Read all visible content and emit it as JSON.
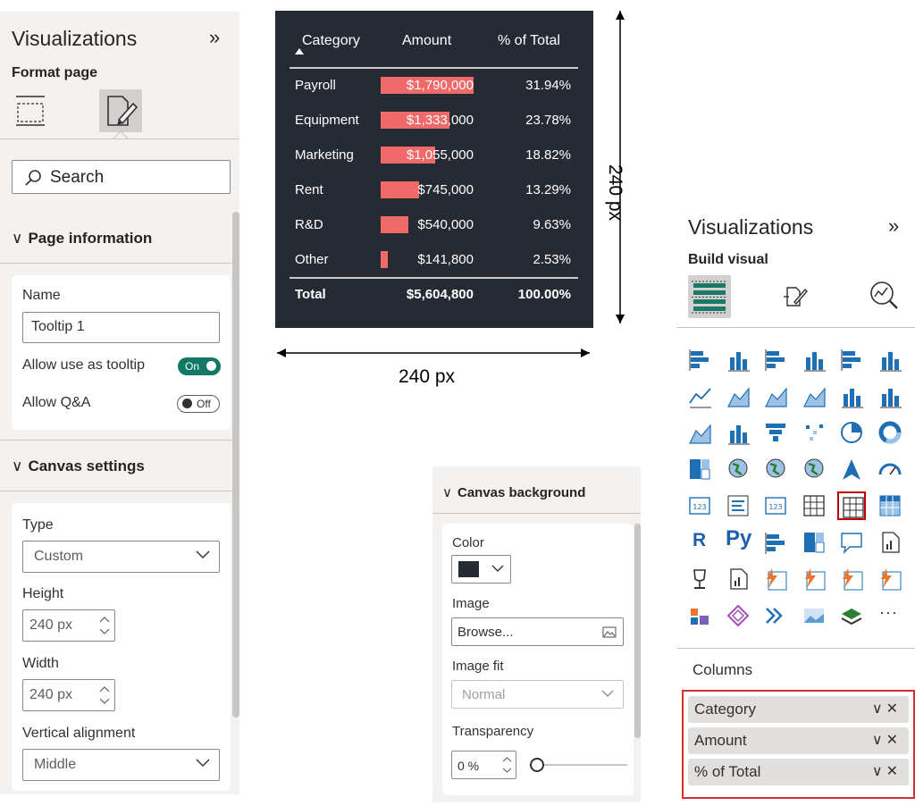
{
  "left_pane": {
    "title": "Visualizations",
    "collapse": "»",
    "subtitle": "Format page",
    "search": {
      "placeholder": "Search"
    },
    "page_info": {
      "header": "Page information",
      "name_label": "Name",
      "name_value": "Tooltip 1",
      "tooltip_label": "Allow use as tooltip",
      "tooltip_state": "On",
      "qa_label": "Allow Q&A",
      "qa_state": "Off"
    },
    "canvas_settings": {
      "header": "Canvas settings",
      "type_label": "Type",
      "type_value": "Custom",
      "height_label": "Height",
      "height_value": "240 px",
      "width_label": "Width",
      "width_value": "240 px",
      "valign_label": "Vertical alignment",
      "valign_value": "Middle"
    }
  },
  "tooltip_table": {
    "headers": [
      "Category",
      "Amount",
      "% of Total"
    ],
    "rows": [
      {
        "category": "Payroll",
        "amount": "$1,790,000",
        "pct": "31.94%",
        "share": 0.3194
      },
      {
        "category": "Equipment",
        "amount": "$1,333,000",
        "pct": "23.78%",
        "share": 0.2378
      },
      {
        "category": "Marketing",
        "amount": "$1,055,000",
        "pct": "18.82%",
        "share": 0.1882
      },
      {
        "category": "Rent",
        "amount": "$745,000",
        "pct": "13.29%",
        "share": 0.1329
      },
      {
        "category": "R&D",
        "amount": "$540,000",
        "pct": "9.63%",
        "share": 0.0963
      },
      {
        "category": "Other",
        "amount": "$141,800",
        "pct": "2.53%",
        "share": 0.0253
      }
    ],
    "total": {
      "category": "Total",
      "amount": "$5,604,800",
      "pct": "100.00%"
    },
    "colors": {
      "background": "#262a33",
      "bar": "#ef6a68"
    }
  },
  "dimensions": {
    "width_label": "240 px",
    "height_label": "240 px"
  },
  "canvas_background": {
    "header": "Canvas background",
    "color_label": "Color",
    "color_value": "#262a33",
    "image_label": "Image",
    "browse_label": "Browse...",
    "fit_label": "Image fit",
    "fit_value": "Normal",
    "transparency_label": "Transparency",
    "transparency_value": "0 %"
  },
  "right_pane": {
    "title": "Visualizations",
    "collapse": "»",
    "subtitle": "Build visual",
    "columns_label": "Columns",
    "fields": [
      "Category",
      "Amount",
      "% of Total"
    ],
    "field_ops": "∨✕",
    "gallery": [
      "stacked-bar-icon",
      "stacked-column-icon",
      "clustered-bar-icon",
      "clustered-column-icon",
      "100-bar-icon",
      "100-column-icon",
      "line-chart-icon",
      "area-chart-icon",
      "stacked-area-icon",
      "ribbon-icon",
      "line-clustered-icon",
      "line-stacked-icon",
      "ribbon-chart-icon",
      "waterfall-icon",
      "funnel-icon",
      "scatter-icon",
      "pie-icon",
      "donut-icon",
      "treemap-icon",
      "map-icon",
      "filled-map-icon",
      "shape-map-icon",
      "azure-map-icon",
      "gauge-icon",
      "card-icon",
      "multirow-card-icon",
      "kpi-icon",
      "slicer-icon",
      "table-icon",
      "matrix-icon",
      "r-visual-icon",
      "python-visual-icon",
      "key-influencers-icon",
      "decomposition-tree-icon",
      "qa-icon",
      "narrative-icon",
      "goals-icon",
      "paginated-icon",
      "power-apps-icon",
      "power-automate-icon",
      "custom-visual-a-icon",
      "custom-visual-b-icon",
      "custom-visual-c-icon",
      "custom-visual-d-icon",
      "custom-visual-e-icon",
      "custom-visual-f-icon",
      "custom-visual-g-icon",
      "more-icon"
    ],
    "gallery_text": {
      "r-visual-icon": "R",
      "python-visual-icon": "Py",
      "card-icon": "123"
    },
    "selected_visual": "table-icon",
    "more_glyph": "···"
  }
}
